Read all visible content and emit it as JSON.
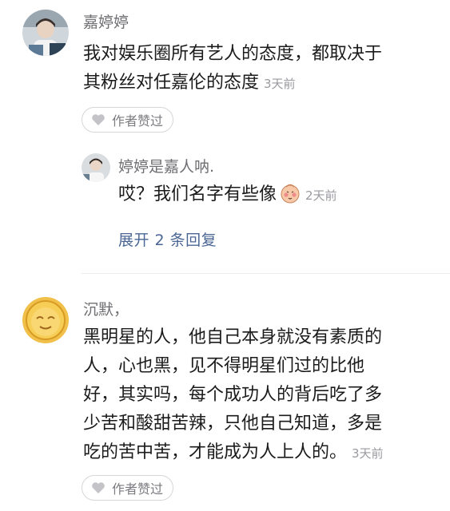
{
  "comments": [
    {
      "username": "嘉婷婷",
      "lines": [
        "我对娱乐圈所有艺人的态度，都取决于",
        "其粉丝对任嘉伦的态度"
      ],
      "time": "3天前",
      "liked_label": "作者赞过",
      "replies": [
        {
          "username": "婷婷是嘉人呐.",
          "text": "哎？我们名字有些像",
          "emoji": "blushing-face-emoji",
          "time": "2天前"
        }
      ],
      "expand_label": "展开 2 条回复"
    },
    {
      "username": "沉默，",
      "lines": [
        "黑明星的人，他自己本身就没有素质的",
        "人，心也黑，见不得明星们过的比他",
        "好，其实吗，每个成功人的背后吃了多",
        "少苦和酸甜苦辣，只他自己知道，多是",
        "吃的苦中苦，才能成为人上人的。"
      ],
      "time": "3天前",
      "liked_label": "作者赞过"
    }
  ],
  "icons": {
    "heart": "heart-icon"
  },
  "colors": {
    "username": "#6f6f73",
    "expand_link": "#4a6694",
    "timestamp": "#9a9aa0"
  }
}
